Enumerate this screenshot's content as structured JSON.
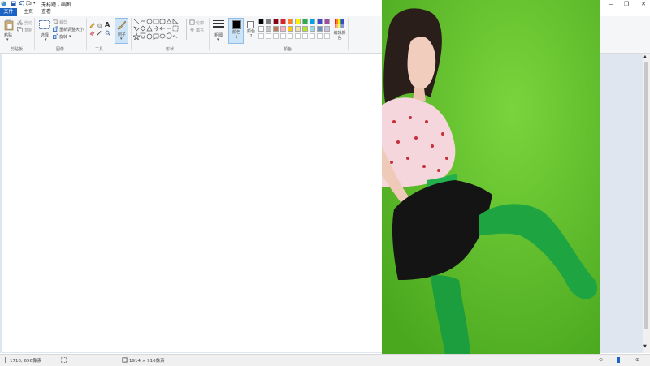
{
  "window": {
    "title": "无标题 - 画图",
    "minimize": "—",
    "maximize": "❐",
    "close": "✕"
  },
  "tabs": [
    "文件",
    "主页",
    "查看"
  ],
  "ribbon": {
    "clipboard": {
      "paste": "粘贴",
      "cut": "剪切",
      "copy": "复制",
      "label": "剪贴板"
    },
    "image": {
      "select": "选择",
      "crop": "裁剪",
      "resize": "重新调整大小",
      "rotate": "旋转",
      "label": "图像"
    },
    "tools": {
      "brush": "刷子",
      "label": "工具"
    },
    "shapes": {
      "outline": "轮廓",
      "fill": "填充",
      "label": "形状"
    },
    "colors": {
      "size": "粗细",
      "color1": "颜色 1",
      "color2": "颜色 2",
      "edit": "编辑颜色",
      "label": "颜色",
      "palette": [
        "#000000",
        "#7f7f7f",
        "#880015",
        "#ed1c24",
        "#ff7f27",
        "#fff200",
        "#22b14c",
        "#00a2e8",
        "#3f48cc",
        "#a349a4",
        "#ffffff",
        "#c3c3c3",
        "#b97a57",
        "#ffaec9",
        "#ffc90e",
        "#efe4b0",
        "#b5e61d",
        "#99d9ea",
        "#7092be",
        "#c8bfe7"
      ],
      "color1_value": "#000000",
      "color2_value": "#ffffff"
    }
  },
  "status": {
    "cursor": "1710, 656像素",
    "size": "1914 × 916像素"
  }
}
